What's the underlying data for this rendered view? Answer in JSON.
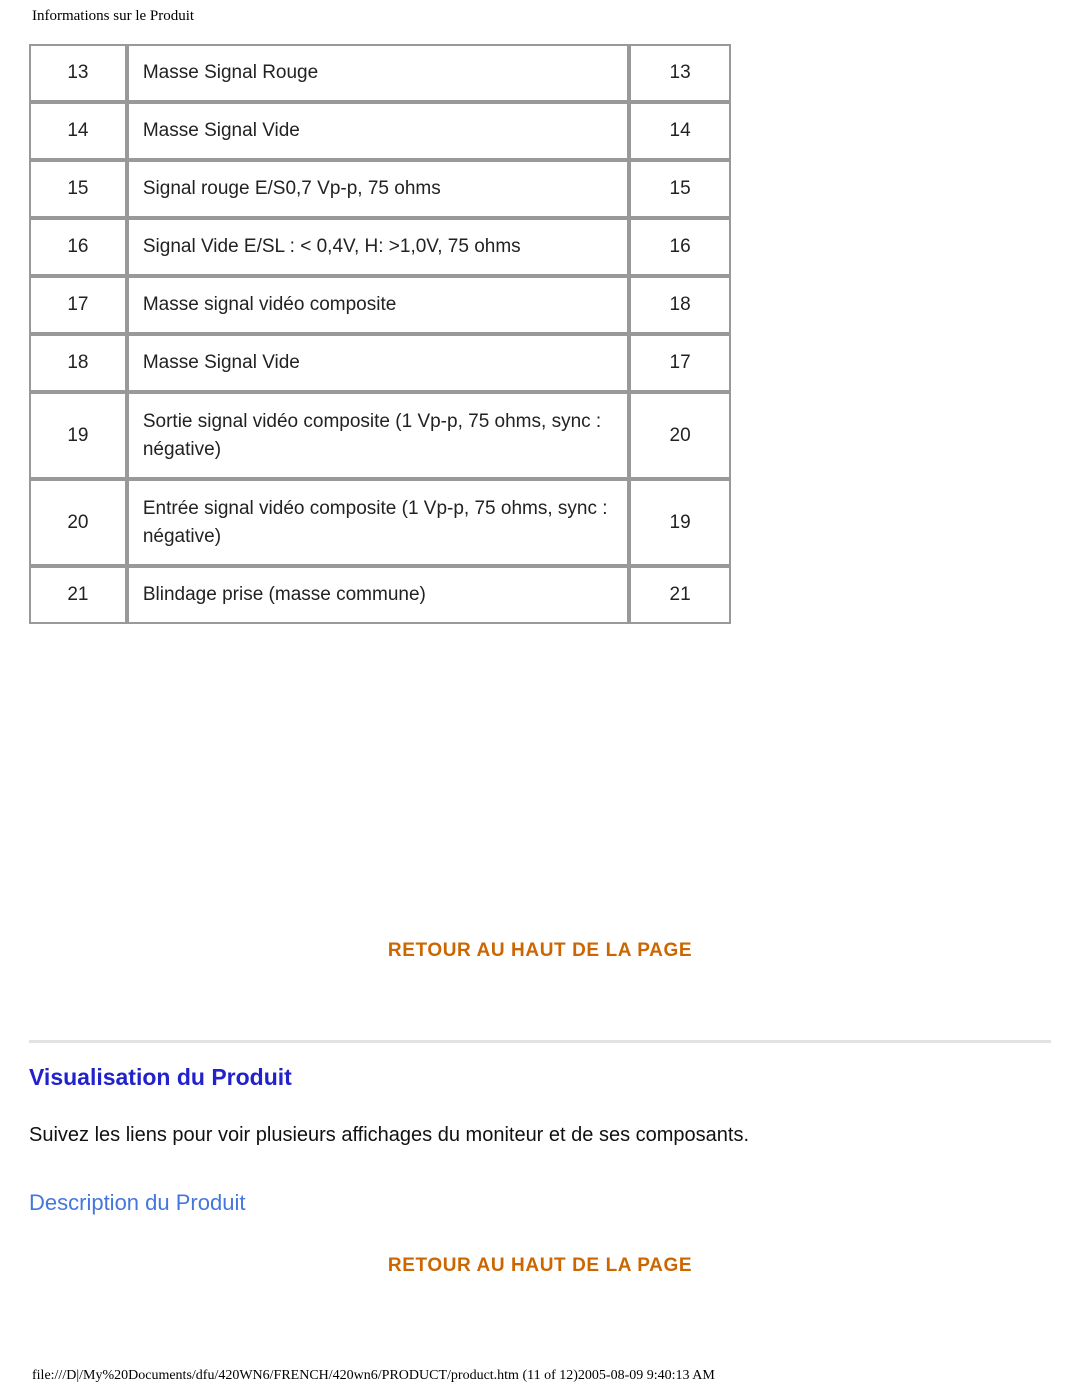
{
  "header": {
    "title": "Informations sur le Produit"
  },
  "pin_table": {
    "rows": [
      {
        "pin": "13",
        "description": "Masse Signal Rouge",
        "pin2": "13"
      },
      {
        "pin": "14",
        "description": "Masse Signal Vide",
        "pin2": "14"
      },
      {
        "pin": "15",
        "description": "Signal rouge E/S0,7 Vp-p, 75 ohms",
        "pin2": "15"
      },
      {
        "pin": "16",
        "description": "Signal Vide E/SL : < 0,4V, H: >1,0V, 75 ohms",
        "pin2": "16"
      },
      {
        "pin": "17",
        "description": "Masse signal vidéo composite",
        "pin2": "18"
      },
      {
        "pin": "18",
        "description": "Masse Signal Vide",
        "pin2": "17"
      },
      {
        "pin": "19",
        "description": "Sortie signal vidéo composite (1 Vp-p, 75 ohms, sync : négative)",
        "pin2": "20"
      },
      {
        "pin": "20",
        "description": "Entrée signal vidéo composite (1 Vp-p, 75 ohms, sync : négative)",
        "pin2": "19"
      },
      {
        "pin": "21",
        "description": "Blindage prise (masse commune)",
        "pin2": "21"
      }
    ]
  },
  "links": {
    "back_to_top_1": "RETOUR AU HAUT DE LA PAGE",
    "back_to_top_2": "RETOUR AU HAUT DE LA PAGE",
    "product_description": "Description du Produit"
  },
  "section": {
    "title": "Visualisation du Produit",
    "body": "Suivez les liens pour voir plusieurs affichages du moniteur et de ses composants."
  },
  "footer": {
    "path": "file:///D|/My%20Documents/dfu/420WN6/FRENCH/420wn6/PRODUCT/product.htm (11 of 12)2005-08-09 9:40:13 AM"
  },
  "colors": {
    "link_orange": "#CC6600",
    "heading_blue": "#2222CC",
    "sublink_blue": "#4477DD",
    "table_border": "#999999"
  }
}
